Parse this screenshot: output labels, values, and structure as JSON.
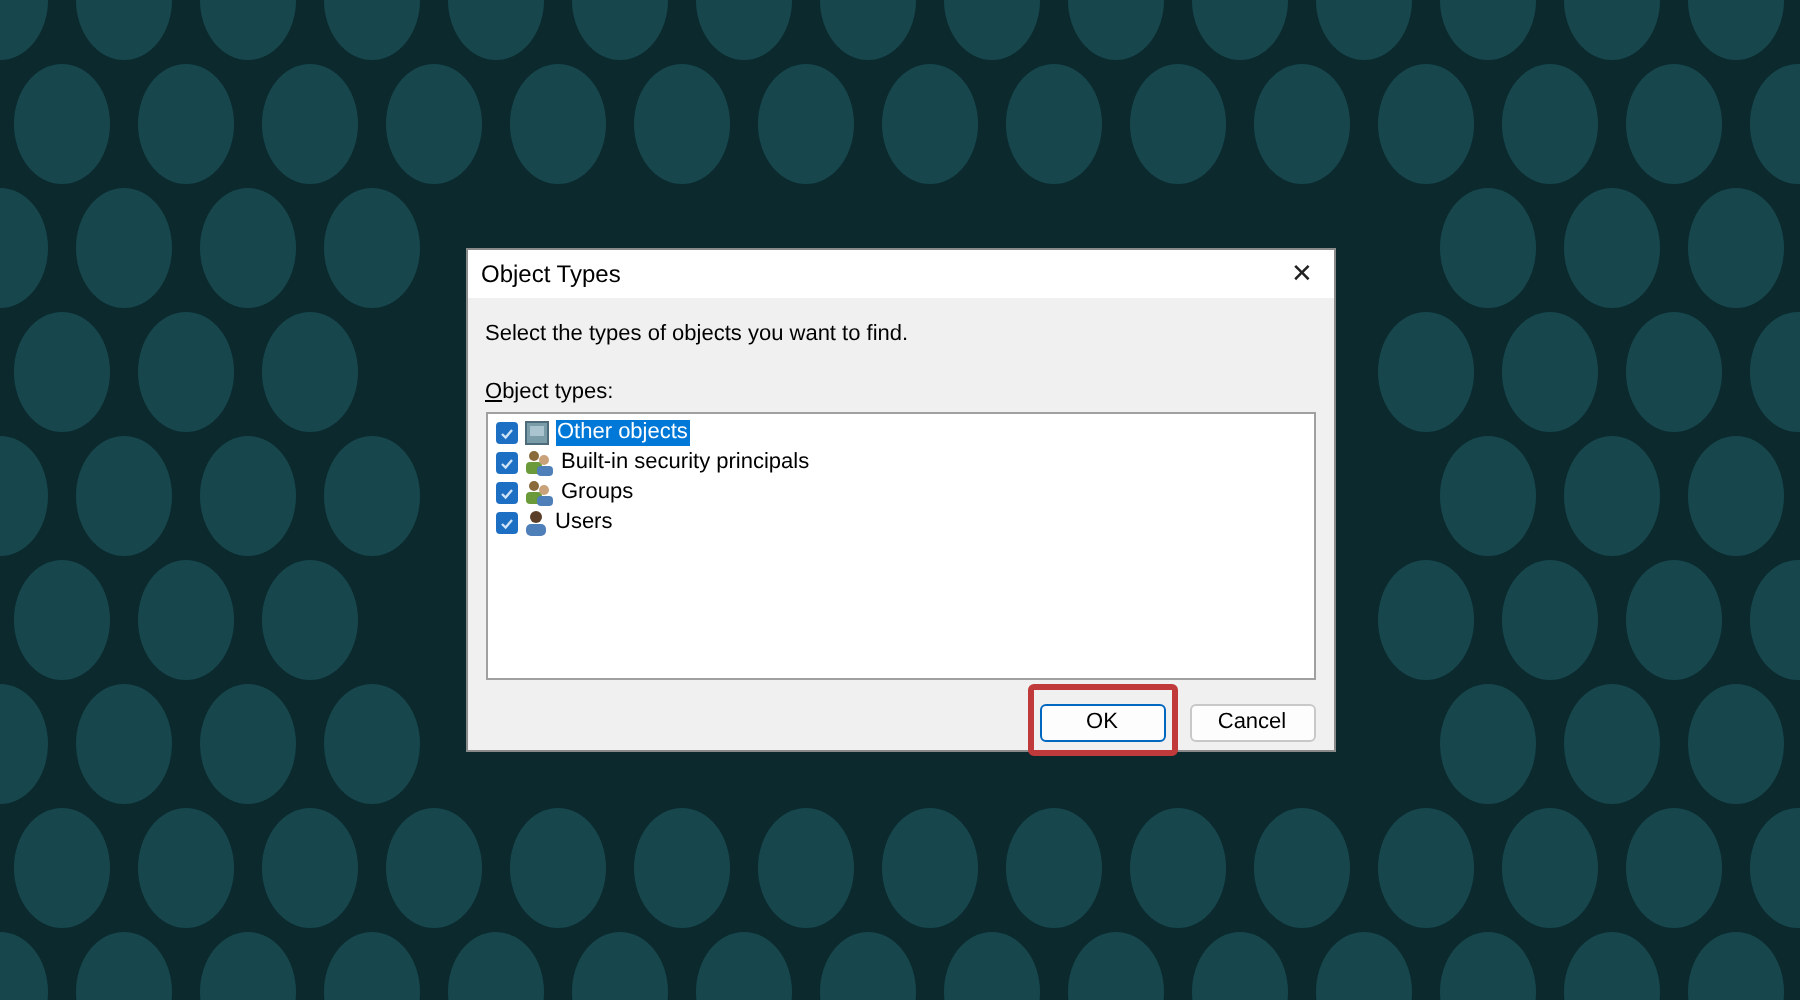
{
  "dialog": {
    "title": "Object Types",
    "close": "✕",
    "instruction": "Select the types of objects you want to find.",
    "list_label": "Object types:",
    "items": [
      {
        "label": "Other objects",
        "kind": "computer",
        "checked": true,
        "selected": true
      },
      {
        "label": "Built-in security principals",
        "kind": "group",
        "checked": true,
        "selected": false
      },
      {
        "label": "Groups",
        "kind": "group",
        "checked": true,
        "selected": false
      },
      {
        "label": "Users",
        "kind": "user",
        "checked": true,
        "selected": false
      }
    ],
    "buttons": [
      {
        "label": "OK",
        "default": true,
        "highlighted": true
      },
      {
        "label": "Cancel",
        "default": false,
        "highlighted": false
      }
    ]
  }
}
